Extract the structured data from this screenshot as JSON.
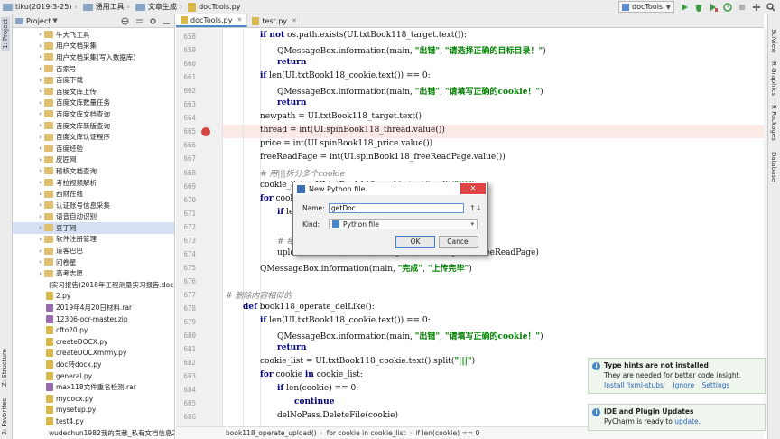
{
  "breadcrumb": [
    "tiku(2019-3-25)",
    "通用工具",
    "文章生成",
    "docTools.py"
  ],
  "run_config": {
    "label": "docTools"
  },
  "toolbar_icons": [
    "run-icon",
    "debug-icon",
    "coverage-icon",
    "profile-icon",
    "stop-icon",
    "tools-icon",
    "search-icon"
  ],
  "left_strip": {
    "project": "1: Project",
    "structure": "Z: Structure",
    "favorites": "2: Favorites"
  },
  "right_strip": [
    "SciView",
    "R Graphics",
    "R Packages",
    "Database"
  ],
  "project_panel": {
    "title": "Project",
    "items": [
      {
        "label": "牛大飞工具",
        "type": "folder",
        "arrow": "›"
      },
      {
        "label": "用户文档采集",
        "type": "folder",
        "arrow": "›"
      },
      {
        "label": "用户文档采集(写入数据库)",
        "type": "folder",
        "arrow": "›"
      },
      {
        "label": "百家号",
        "type": "folder",
        "arrow": "›"
      },
      {
        "label": "百度下载",
        "type": "folder",
        "arrow": "›"
      },
      {
        "label": "百度文库上传",
        "type": "folder",
        "arrow": "›"
      },
      {
        "label": "百度文库数量任务",
        "type": "folder",
        "arrow": "›"
      },
      {
        "label": "百度文库文档查询",
        "type": "folder",
        "arrow": "›"
      },
      {
        "label": "百度文库新版查询",
        "type": "folder",
        "arrow": "›"
      },
      {
        "label": "百度文库认证程序",
        "type": "folder",
        "arrow": "›"
      },
      {
        "label": "百度经验",
        "type": "folder",
        "arrow": "›"
      },
      {
        "label": "皮匠网",
        "type": "folder",
        "arrow": "›"
      },
      {
        "label": "稽核文档查询",
        "type": "folder",
        "arrow": "›"
      },
      {
        "label": "考拉视频解析",
        "type": "folder",
        "arrow": "›"
      },
      {
        "label": "西财在线",
        "type": "folder",
        "arrow": "›"
      },
      {
        "label": "认证账号信息采集",
        "type": "folder",
        "arrow": "›"
      },
      {
        "label": "语音自动识别",
        "type": "folder",
        "arrow": "›"
      },
      {
        "label": "豆丁网",
        "type": "folder",
        "arrow": "›",
        "selected": true
      },
      {
        "label": "软件注册管理",
        "type": "folder",
        "arrow": "›"
      },
      {
        "label": "道客巴巴",
        "type": "folder",
        "arrow": "›"
      },
      {
        "label": "问卷星",
        "type": "folder",
        "arrow": "›"
      },
      {
        "label": "高考志愿",
        "type": "folder",
        "arrow": "›"
      },
      {
        "label": "(实习报告)2018年工程测量实习报告.docx",
        "type": "file",
        "color": "#4a7fc1"
      },
      {
        "label": "2.py",
        "type": "file",
        "color": "#d9b84a"
      },
      {
        "label": "2019年4月20日材料.rar",
        "type": "file",
        "color": "#9b6bb0"
      },
      {
        "label": "12306-ocr-master.zip",
        "type": "file",
        "color": "#9b6bb0"
      },
      {
        "label": "cfto20.py",
        "type": "file",
        "color": "#d9b84a"
      },
      {
        "label": "createDOCX.py",
        "type": "file",
        "color": "#d9b84a"
      },
      {
        "label": "createDOCXmrmy.py",
        "type": "file",
        "color": "#d9b84a"
      },
      {
        "label": "doc转docx.py",
        "type": "file",
        "color": "#d9b84a"
      },
      {
        "label": "general.py",
        "type": "file",
        "color": "#d9b84a"
      },
      {
        "label": "max118文件重名检测.rar",
        "type": "file",
        "color": "#9b6bb0"
      },
      {
        "label": "mydocx.py",
        "type": "file",
        "color": "#d9b84a"
      },
      {
        "label": "mysetup.py",
        "type": "file",
        "color": "#d9b84a"
      },
      {
        "label": "test4.py",
        "type": "file",
        "color": "#d9b84a"
      },
      {
        "label": "wudechun1982我的贡献_私有文档信息2",
        "type": "file",
        "color": "#4aa05a"
      }
    ]
  },
  "tabs": [
    {
      "label": "docTools.py",
      "active": true
    },
    {
      "label": "test.py",
      "active": false
    }
  ],
  "editor": {
    "line_numbers": [
      "658",
      "659",
      "660",
      "661",
      "662",
      "663",
      "664",
      "665",
      "666",
      "667",
      "668",
      "669",
      "670",
      "671",
      "672",
      "673",
      "674",
      "675",
      "676",
      "677",
      "678",
      "679",
      "680",
      "681",
      "682",
      "683",
      "684",
      "685",
      "686",
      "687",
      "688"
    ],
    "breakpoint_line": "665",
    "lines": [
      {
        "indent": 2,
        "html": "<span class='kw'>if not</span> os.path.exists(UI.txtBook118_target.text()):"
      },
      {
        "indent": 3,
        "html": "QMessageBox.information(main, <span class='str'>\"出错\"</span>, <span class='str'>\"请选择正确的目标目录！\"</span>)"
      },
      {
        "indent": 3,
        "html": "<span class='kw'>return</span>"
      },
      {
        "indent": 2,
        "html": "<span class='kw'>if</span> len(UI.txtBook118_cookie.text()) == 0:"
      },
      {
        "indent": 3,
        "html": "QMessageBox.information(main, <span class='str'>\"出错\"</span>, <span class='str'>\"请填写正确的cookie！\"</span>)"
      },
      {
        "indent": 3,
        "html": "<span class='kw'>return</span>"
      },
      {
        "indent": 2,
        "html": "newpath = UI.txtBook118_target.text()"
      },
      {
        "indent": 2,
        "html": "thread = int(UI.spinBook118_thread.value())"
      },
      {
        "indent": 2,
        "html": "price = int(UI.spinBook118_price.value())"
      },
      {
        "indent": 2,
        "html": "freeReadPage = int(UI.spinBook118_freeReadPage.value())"
      },
      {
        "indent": 2,
        "html": "<span class='cm'># 用|||拆分多个cookie</span>"
      },
      {
        "indent": 2,
        "html": "cookie_list = UI.txtBook118_cookie.text().split(<span class='str'>\"|||\"</span>)"
      },
      {
        "indent": 2,
        "html": "<span class='kw'>for</span> cookie <span class='kw'>in</span> cookie_list:"
      },
      {
        "indent": 3,
        "html": "<span class='kw'>if</span> len(cookie) == 0:"
      },
      {
        "indent": 4,
        "html": "<span class='kw'>continue</span>"
      },
      {
        "indent": 3,
        "html": "<span class='cm'># 每个cookie分配一个线程</span>"
      },
      {
        "indent": 3,
        "html": "upload.Book118(cookie, newpath, thread, price, freeReadPage)"
      },
      {
        "indent": 2,
        "html": "QMessageBox.information(main, <span class='str'>\"完成\"</span>, <span class='str'>\"上传完毕\"</span>)"
      },
      {
        "indent": 0,
        "html": ""
      },
      {
        "indent": 0,
        "html": "<span class='cm'># 删除内容相似的</span>"
      },
      {
        "indent": 1,
        "html": "<span class='kw'>def</span> book118_operate_delLike():"
      },
      {
        "indent": 2,
        "html": "<span class='kw'>if</span> len(UI.txtBook118_cookie.text()) == 0:"
      },
      {
        "indent": 3,
        "html": "QMessageBox.information(main, <span class='str'>\"出错\"</span>, <span class='str'>\"请填写正确的cookie！\"</span>)"
      },
      {
        "indent": 3,
        "html": "<span class='kw'>return</span>"
      },
      {
        "indent": 2,
        "html": "cookie_list = UI.txtBook118_cookie.text().split(<span class='str'>\"|||\"</span>)"
      },
      {
        "indent": 2,
        "html": "<span class='kw'>for</span> cookie <span class='kw'>in</span> cookie_list:"
      },
      {
        "indent": 3,
        "html": "<span class='kw'>if</span> len(cookie) == 0:"
      },
      {
        "indent": 4,
        "html": "<span class='kw'>continue</span>"
      },
      {
        "indent": 3,
        "html": "delNoPass.DeleteFile(cookie)"
      },
      {
        "indent": 2,
        "html": "QMessageBox.information(main, <span class='str'>\"完成\"</span>, <span class='str'>\"删除完毕\"</span>)"
      },
      {
        "indent": 0,
        "html": ""
      }
    ]
  },
  "editor_breadcrumb": [
    "book118_operate_upload()",
    "for cookie in cookie_list",
    "if len(cookie) == 0"
  ],
  "dialog": {
    "title": "New Python file",
    "close_label": "✕",
    "name_label": "Name:",
    "name_value": "getDoc",
    "kind_label": "Kind:",
    "kind_value": "Python file",
    "ok_label": "OK",
    "cancel_label": "Cancel"
  },
  "notifications": [
    {
      "title": "Type hints are not installed",
      "body": "They are needed for better code insight.",
      "links": [
        "Install 'lxml-stubs'",
        "Ignore",
        "Settings"
      ]
    },
    {
      "title": "IDE and Plugin Updates",
      "body_prefix": "PyCharm is ready to ",
      "body_link": "update",
      "body_suffix": "."
    }
  ]
}
